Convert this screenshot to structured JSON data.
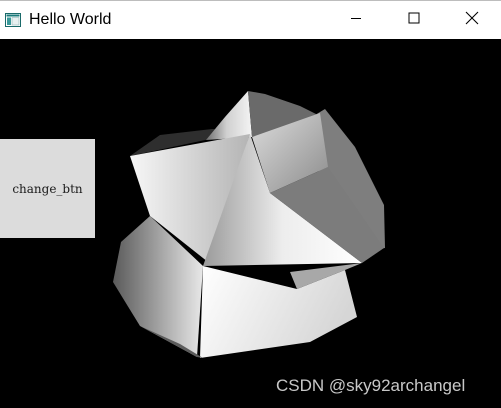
{
  "window": {
    "title": "Hello World",
    "icon": "qt-window-icon",
    "controls": {
      "minimize_icon": "minimize-icon",
      "maximize_icon": "maximize-icon",
      "close_icon": "close-icon"
    }
  },
  "client": {
    "background": "#000000",
    "change_button_label": "change_btn",
    "shape_colors": [
      "#ffffff",
      "#c8c8c8",
      "#7a7a7a",
      "#3c3c3c"
    ]
  },
  "watermark": {
    "text": "CSDN @sky92archangel"
  }
}
